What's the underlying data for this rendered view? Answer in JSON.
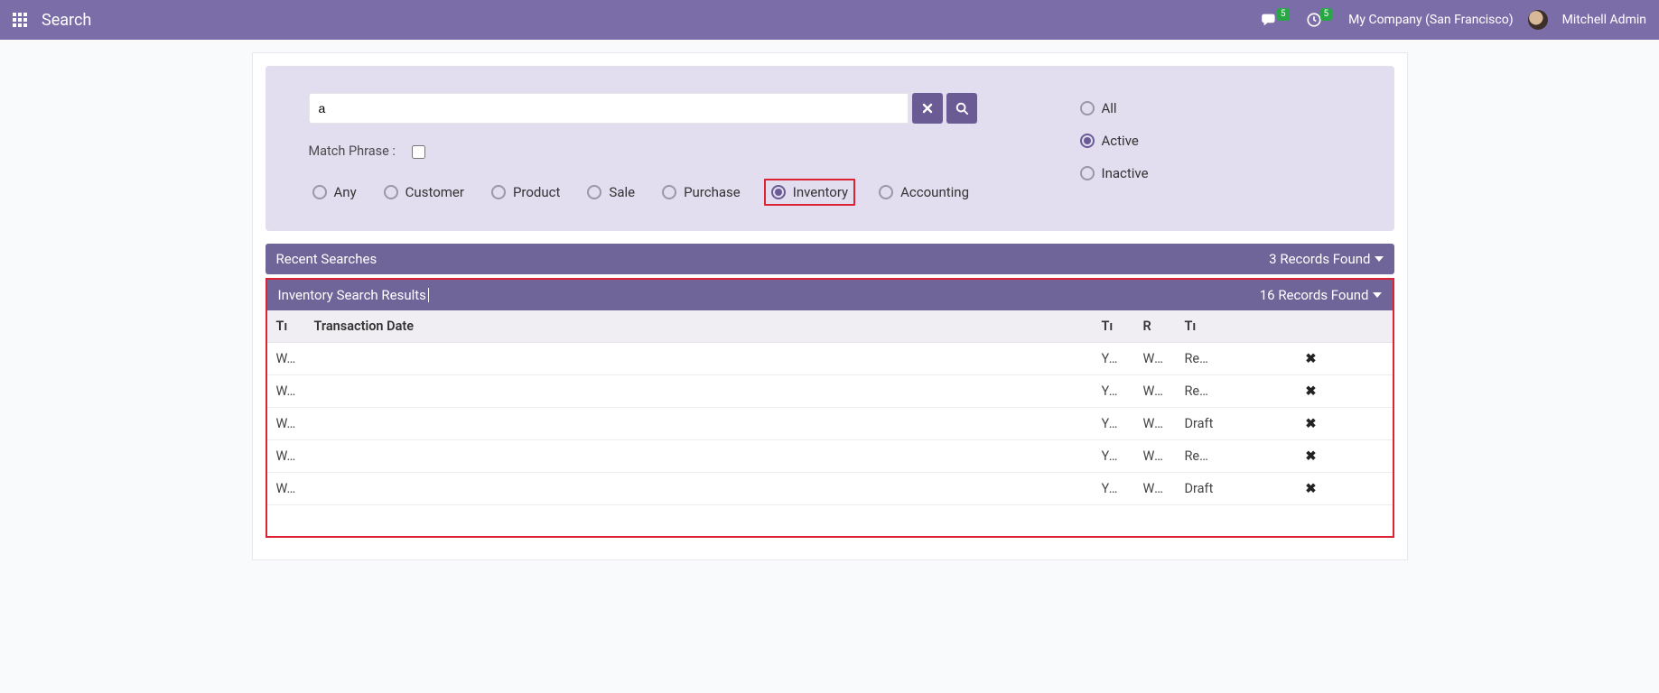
{
  "navbar": {
    "title": "Search",
    "company": "My Company (San Francisco)",
    "user": "Mitchell Admin",
    "msg_badge": "5",
    "clock_badge": "5"
  },
  "search": {
    "value": "a",
    "match_label": "Match Phrase :",
    "categories": [
      {
        "key": "any",
        "label": "Any"
      },
      {
        "key": "customer",
        "label": "Customer"
      },
      {
        "key": "product",
        "label": "Product"
      },
      {
        "key": "sale",
        "label": "Sale"
      },
      {
        "key": "purchase",
        "label": "Purchase"
      },
      {
        "key": "inventory",
        "label": "Inventory"
      },
      {
        "key": "accounting",
        "label": "Accounting"
      }
    ],
    "selected_category": "inventory",
    "statuses": [
      {
        "key": "all",
        "label": "All"
      },
      {
        "key": "active",
        "label": "Active"
      },
      {
        "key": "inactive",
        "label": "Inactive"
      }
    ],
    "selected_status": "active"
  },
  "recent": {
    "title": "Recent Searches",
    "count_label": "3 Records Found"
  },
  "results": {
    "title": "Inventory Search Results",
    "count_label": "16 Records Found",
    "columns": {
      "c0": "Tı",
      "c1": "Transaction Date",
      "c2": "Tı",
      "c3": "R",
      "c4": "Tı"
    },
    "rows": [
      {
        "c0": "W…",
        "c1": "",
        "c2": "Yo…",
        "c3": "Wo…",
        "c4": "Re…"
      },
      {
        "c0": "W…",
        "c1": "",
        "c2": "Yo…",
        "c3": "Wo…",
        "c4": "Re…"
      },
      {
        "c0": "W…",
        "c1": "",
        "c2": "Yo…",
        "c3": "Wo…",
        "c4": "Draft"
      },
      {
        "c0": "W…",
        "c1": "",
        "c2": "Yo…",
        "c3": "Wo…",
        "c4": "Re…"
      },
      {
        "c0": "W…",
        "c1": "",
        "c2": "Yo…",
        "c3": "Wo…",
        "c4": "Draft"
      }
    ]
  }
}
